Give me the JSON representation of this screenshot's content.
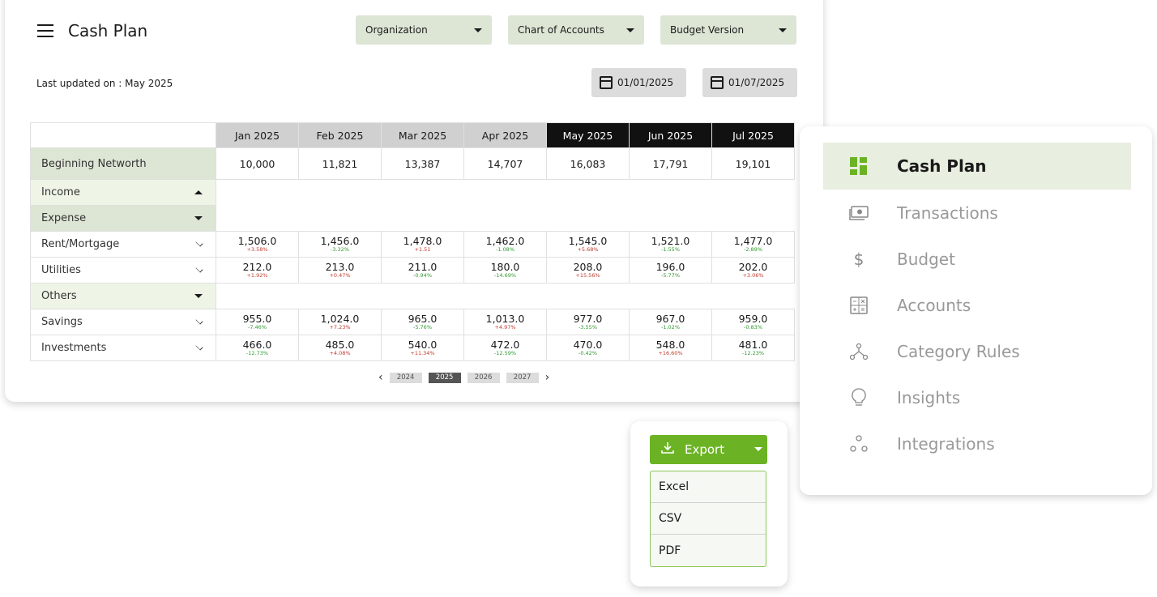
{
  "header": {
    "title": "Cash Plan",
    "filters": [
      "Organization",
      "Chart of Accounts",
      "Budget Version"
    ],
    "last_updated": "Last updated on : May 2025",
    "date_from": "01/01/2025",
    "date_to": "01/07/2025"
  },
  "table": {
    "months": [
      "Jan 2025",
      "Feb 2025",
      "Mar 2025",
      "Apr 2025",
      "May 2025",
      "Jun 2025",
      "Jul 2025"
    ],
    "beginning_networth": {
      "label": "Beginning Networth",
      "values": [
        "10,000",
        "11,821",
        "13,387",
        "14,707",
        "16,083",
        "17,791",
        "19,101"
      ]
    },
    "groups": {
      "income": "Income",
      "expense": "Expense",
      "others": "Others"
    },
    "rows": {
      "rent": {
        "label": "Rent/Mortgage",
        "values": [
          "1,506.0",
          "1,456.0",
          "1,478.0",
          "1,462.0",
          "1,545.0",
          "1,521.0",
          "1,477.0"
        ],
        "changes": [
          "+3.58%",
          "-3.32%",
          "+1.51",
          "-1.08%",
          "+5.68%",
          "-1.55%",
          "-2.89%"
        ]
      },
      "utilities": {
        "label": "Utilities",
        "values": [
          "212.0",
          "213.0",
          "211.0",
          "180.0",
          "208.0",
          "196.0",
          "202.0"
        ],
        "changes": [
          "+1.92%",
          "+0.47%",
          "-0.94%",
          "-14.69%",
          "+15.56%",
          "-5.77%",
          "+3.06%"
        ]
      },
      "savings": {
        "label": "Savings",
        "values": [
          "955.0",
          "1,024.0",
          "965.0",
          "1,013.0",
          "977.0",
          "967.0",
          "959.0"
        ],
        "changes": [
          "-7.46%",
          "+7.23%",
          "-5.76%",
          "+4.97%",
          "-3.55%",
          "-1.02%",
          "-0.83%"
        ]
      },
      "investments": {
        "label": "Investments",
        "values": [
          "466.0",
          "485.0",
          "540.0",
          "472.0",
          "470.0",
          "548.0",
          "481.0"
        ],
        "changes": [
          "-12.73%",
          "+4.08%",
          "+11.34%",
          "-12.59%",
          "-0.42%",
          "+16.60%",
          "-12.23%"
        ]
      }
    }
  },
  "years": [
    "2024",
    "2025",
    "2026",
    "2027"
  ],
  "nav": [
    {
      "label": "Cash Plan",
      "icon": "dashboard-icon"
    },
    {
      "label": "Transactions",
      "icon": "money-icon"
    },
    {
      "label": "Budget",
      "icon": "dollar-icon"
    },
    {
      "label": "Accounts",
      "icon": "calculator-icon"
    },
    {
      "label": "Category Rules",
      "icon": "network-icon"
    },
    {
      "label": "Insights",
      "icon": "lightbulb-icon"
    },
    {
      "label": "Integrations",
      "icon": "integrations-icon"
    }
  ],
  "export": {
    "label": "Export",
    "options": [
      "Excel",
      "CSV",
      "PDF"
    ]
  },
  "colors": {
    "accent": "#6bb324",
    "filter_bg": "#dde5d5",
    "active_month": "#111111"
  }
}
